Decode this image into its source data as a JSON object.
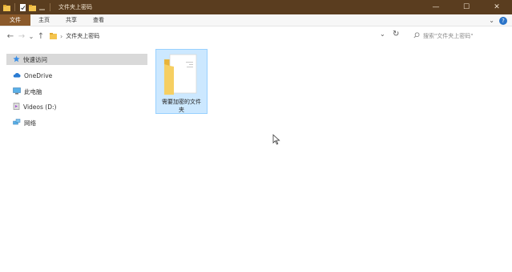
{
  "window": {
    "title": "文件夹上密码",
    "controls": {
      "minimize": "—",
      "maximize": "☐",
      "close": "✕"
    }
  },
  "ribbon": {
    "tabs": [
      "文件",
      "主页",
      "共享",
      "查看"
    ],
    "collapse_glyph": "⌄",
    "help_glyph": "?"
  },
  "address_bar": {
    "back": "←",
    "forward": "→",
    "recent": "⌄",
    "up": "↑",
    "path": [
      "文件夹上密码"
    ],
    "dropdown": "⌄",
    "refresh": "↻"
  },
  "search": {
    "placeholder": "搜索\"文件夹上密码\""
  },
  "sidebar": {
    "items": [
      {
        "label": "快速访问",
        "icon": "star-icon",
        "selected": true
      },
      {
        "label": "OneDrive",
        "icon": "cloud-icon",
        "selected": false
      },
      {
        "label": "此电脑",
        "icon": "computer-icon",
        "selected": false
      },
      {
        "label": "Videos (D:)",
        "icon": "drive-icon",
        "selected": false
      },
      {
        "label": "网络",
        "icon": "network-icon",
        "selected": false
      }
    ]
  },
  "content": {
    "items": [
      {
        "line1": "需要加密的文件",
        "line2": "夹",
        "icon": "folder-icon",
        "selected": true
      }
    ]
  },
  "colors": {
    "titlebar": "#5a3d1f",
    "file_tab": "#8b5a2b",
    "selection": "#cce8ff",
    "selection_border": "#99d1ff",
    "sidebar_selected": "#d9d9d9"
  }
}
